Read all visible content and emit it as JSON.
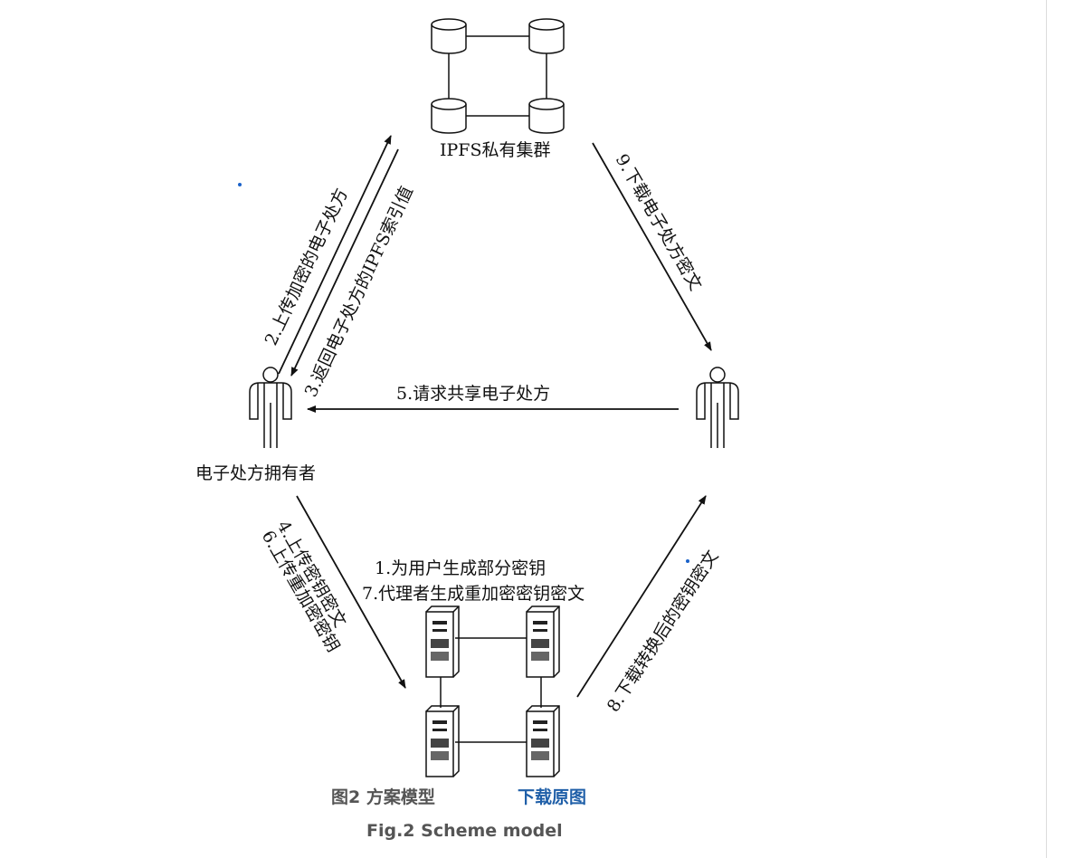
{
  "nodes": {
    "ipfs_cluster": "IPFS私有集群",
    "owner": "电子处方拥有者"
  },
  "edges": {
    "e1": "1.为用户生成部分密钥",
    "e7": "7.代理者生成重加密密钥密文",
    "e2": "2.上传加密的电子处方",
    "e3": "3.返回电子处方的IPFS索引值",
    "e4": "4.上传密钥密文",
    "e5": "5.请求共享电子处方",
    "e6": "6.上传重加密密钥",
    "e8": "8.下载转换后的密钥密文",
    "e9": "9.下载电子处方密文"
  },
  "caption": {
    "cn": "图2 方案模型",
    "download": "下载原图",
    "en": "Fig.2 Scheme model"
  },
  "colors": {
    "line": "#111111",
    "caption_gray": "#555555",
    "link_blue": "#1f5fa8"
  }
}
